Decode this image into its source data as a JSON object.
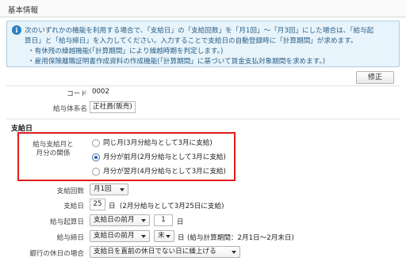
{
  "section_header": "基本情報",
  "info": {
    "icon": "info-icon",
    "lines": [
      "次のいずれかの機能を利用する場合で、「支給日」の「支給回数」を「月1回」〜「月3回」にした場合は、「給与起",
      "算日」と「給与締日」を入力してください。入力することで支給日の自動登録時に「計算期間」が求めます。",
      "・有休残の繰越機能(「計算期間」により繰越時期を判定します。)",
      "・雇用保険離職証明書作成資料の作成機能(「計算期間」に基づいて賃金支払対象期間を求めます。)"
    ]
  },
  "edit_button": "修正",
  "code": {
    "label": "コード",
    "value": "0002"
  },
  "salary_system": {
    "label": "給与体系名",
    "value": "正社員(販売)"
  },
  "payment": {
    "title": "支給日",
    "relation": {
      "label_line1": "給与支給月と",
      "label_line2": "月分の関係",
      "options": [
        {
          "text": "同じ月(3月分給与として3月に支給)",
          "checked": false
        },
        {
          "text": "月分が前月(2月分給与として3月に支給)",
          "checked": true
        },
        {
          "text": "月分が翌月(4月分給与として3月に支給)",
          "checked": false
        }
      ]
    },
    "count": {
      "label": "支給回数",
      "value": "月1回"
    },
    "day": {
      "label": "支給日",
      "value": "25",
      "unit": "日",
      "note": "(2月分給与として3月25日に支給)"
    },
    "start": {
      "label": "給与起算日",
      "month": "支給日の前月",
      "day": "1",
      "unit": "日"
    },
    "close": {
      "label": "給与締日",
      "month": "支給日の前月",
      "day": "末",
      "unit": "日",
      "note": "(給与計算期間：2月1日〜2月末日)"
    },
    "holiday": {
      "label": "銀行の休日の場合",
      "value": "支給日を直前の休日でない日に繰上げる"
    }
  }
}
